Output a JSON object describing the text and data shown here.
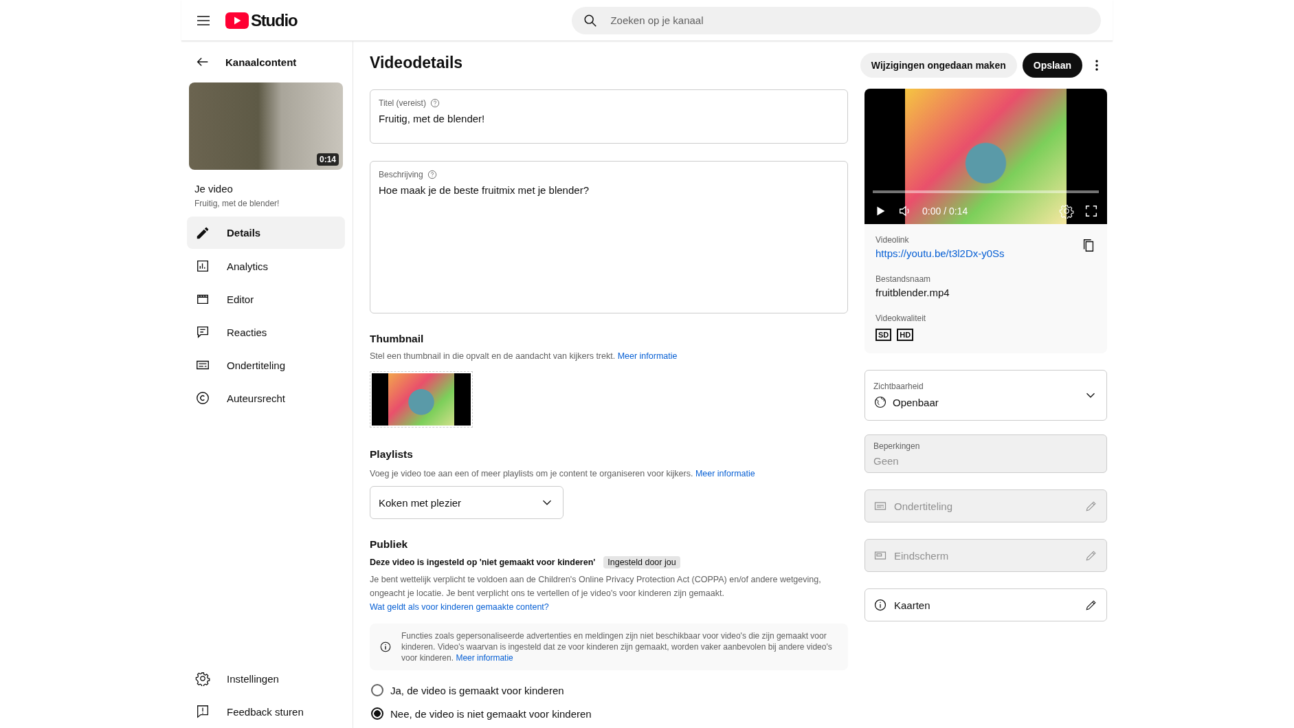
{
  "header": {
    "logo_text": "Studio",
    "search_placeholder": "Zoeken op je kanaal"
  },
  "sidebar": {
    "back_label": "Kanaalcontent",
    "thumbnail_duration": "0:14",
    "video_heading": "Je video",
    "video_title": "Fruitig, met de blender!",
    "items": [
      {
        "label": "Details",
        "selected": true
      },
      {
        "label": "Analytics",
        "selected": false
      },
      {
        "label": "Editor",
        "selected": false
      },
      {
        "label": "Reacties",
        "selected": false
      },
      {
        "label": "Ondertiteling",
        "selected": false
      },
      {
        "label": "Auteursrecht",
        "selected": false
      }
    ],
    "bottom_items": [
      {
        "label": "Instellingen"
      },
      {
        "label": "Feedback sturen"
      }
    ]
  },
  "main": {
    "title": "Videodetails",
    "undo_button": "Wijzigingen ongedaan maken",
    "save_button": "Opslaan",
    "title_field": {
      "label": "Titel (vereist)",
      "value": "Fruitig, met de blender!"
    },
    "description_field": {
      "label": "Beschrijving",
      "value": "Hoe maak je de beste fruitmix met je blender?"
    },
    "thumbnail": {
      "heading": "Thumbnail",
      "text": "Stel een thumbnail in die opvalt en de aandacht van kijkers trekt.",
      "link": "Meer informatie"
    },
    "playlists": {
      "heading": "Playlists",
      "text": "Voeg je video toe aan een of meer playlists om je content te organiseren voor kijkers.",
      "link": "Meer informatie",
      "value": "Koken met plezier"
    },
    "audience": {
      "heading": "Publiek",
      "status": "Deze video is ingesteld op 'niet gemaakt voor kinderen'",
      "badge": "Ingesteld door jou",
      "text": "Je bent wettelijk verplicht te voldoen aan de Children's Online Privacy Protection Act (COPPA) en/of andere wetgeving, ongeacht je locatie. Je bent verplicht ons te vertellen of je video's voor kinderen zijn gemaakt.",
      "link": "Wat geldt als voor kinderen gemaakte content?",
      "notice": {
        "text": "Functies zoals gepersonaliseerde advertenties en meldingen zijn niet beschikbaar voor video's die zijn gemaakt voor kinderen. Video's waarvan is ingesteld dat ze voor kinderen zijn gemaakt, worden vaker aanbevolen bij andere video's voor kinderen.",
        "link": "Meer informatie"
      },
      "options": [
        {
          "label": "Ja, de video is gemaakt voor kinderen",
          "selected": false
        },
        {
          "label": "Nee, de video is niet gemaakt voor kinderen",
          "selected": true
        }
      ]
    }
  },
  "right": {
    "player_time": "0:00 / 0:14",
    "progress": {
      "level": 0
    },
    "videolink": {
      "label": "Videolink",
      "url": "https://youtu.be/t3l2Dx-y0Ss"
    },
    "filename": {
      "label": "Bestandsnaam",
      "value": "fruitblender.mp4"
    },
    "quality": {
      "label": "Videokwaliteit",
      "badges": [
        "SD",
        "HD"
      ]
    },
    "visibility": {
      "label": "Zichtbaarheid",
      "value": "Openbaar"
    },
    "restrictions": {
      "label": "Beperkingen",
      "value": "Geen"
    },
    "rows": [
      {
        "label": "Ondertiteling",
        "disabled": true
      },
      {
        "label": "Eindscherm",
        "disabled": true
      },
      {
        "label": "Kaarten",
        "disabled": false
      }
    ]
  }
}
